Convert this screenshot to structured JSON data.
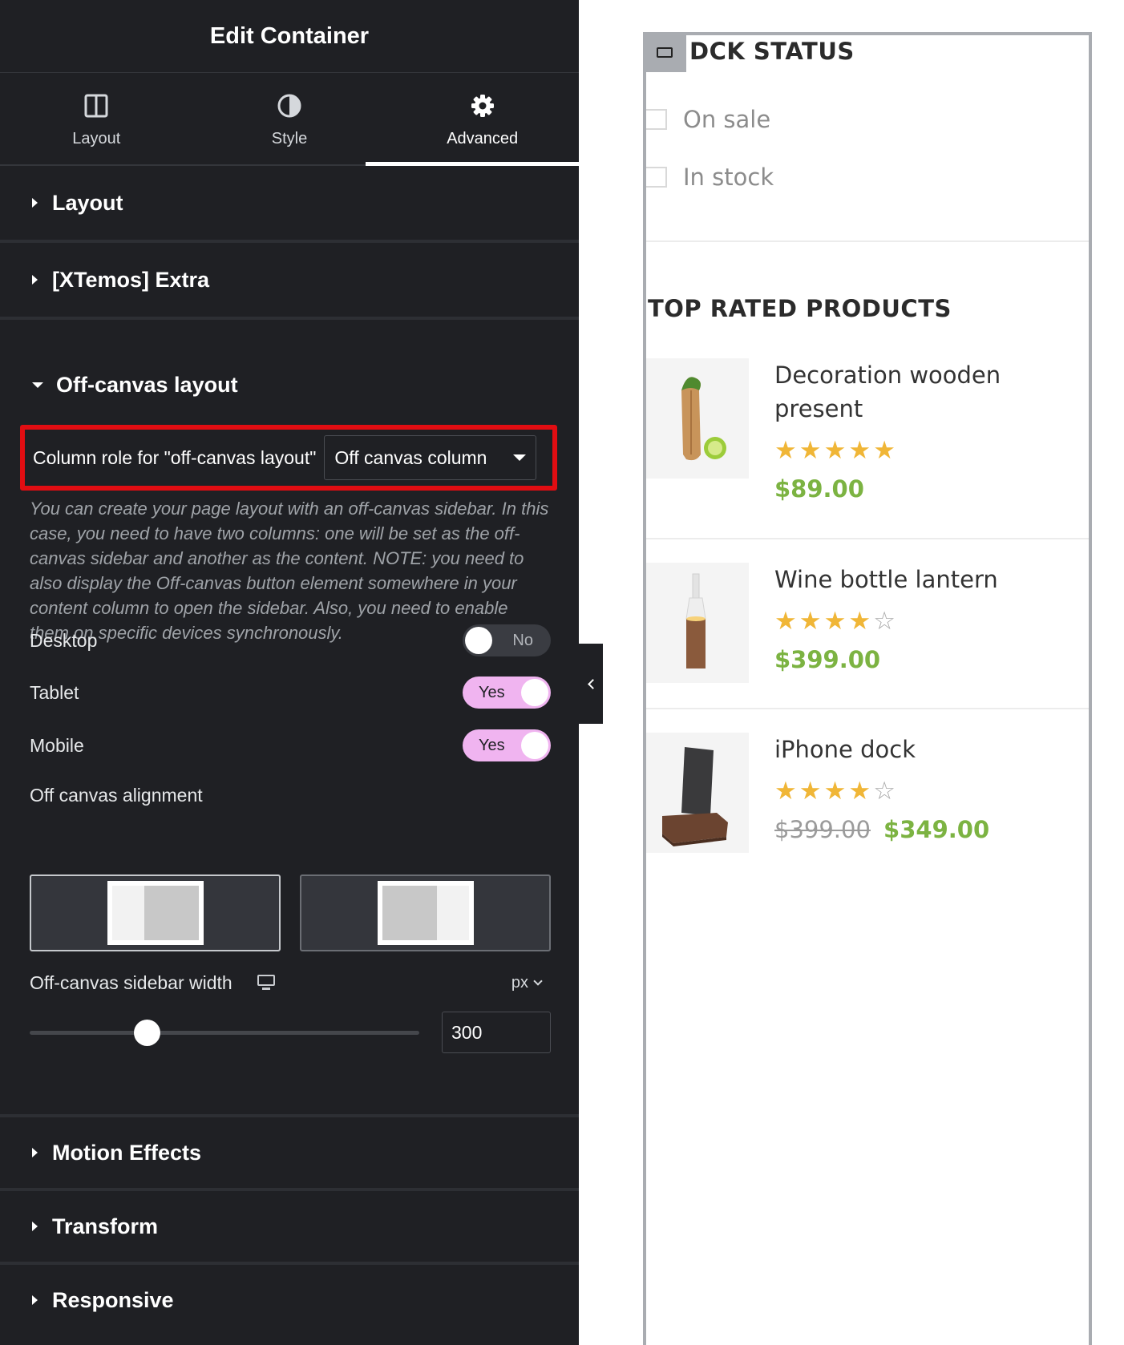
{
  "panel": {
    "title": "Edit Container",
    "tabs": [
      {
        "label": "Layout",
        "icon": "columns-icon",
        "active": false
      },
      {
        "label": "Style",
        "icon": "half-circle-icon",
        "active": false
      },
      {
        "label": "Advanced",
        "icon": "gear-icon",
        "active": true
      }
    ],
    "sections_top": [
      {
        "label": "Layout",
        "expanded": false
      },
      {
        "label": "[XTemos] Extra",
        "expanded": false
      }
    ],
    "offcanvas": {
      "title": "Off-canvas layout",
      "expanded": true,
      "column_role_label": "Column role for \"off-canvas layout\"",
      "column_role_value": "Off canvas column",
      "description": "You can create your page layout with an off-canvas sidebar. In this case, you need to have two columns: one will be set as the off-canvas sidebar and another as the content. NOTE: you need to also display the Off-canvas button element somewhere in your content column to open the sidebar. Also, you need to enable them on specific devices synchronously.",
      "devices": [
        {
          "label": "Desktop",
          "state": "No",
          "on": false
        },
        {
          "label": "Tablet",
          "state": "Yes",
          "on": true
        },
        {
          "label": "Mobile",
          "state": "Yes",
          "on": true
        }
      ],
      "alignment_label": "Off canvas alignment",
      "alignment_options": [
        "left",
        "right"
      ],
      "alignment_selected": "left",
      "sidebar_width_label": "Off-canvas sidebar width",
      "sidebar_width_unit": "px",
      "sidebar_width_value": "300",
      "sidebar_width_slider_fraction": 0.3
    },
    "sections_bottom": [
      {
        "label": "Motion Effects",
        "expanded": false
      },
      {
        "label": "Transform",
        "expanded": false
      },
      {
        "label": "Responsive",
        "expanded": false
      }
    ]
  },
  "preview": {
    "stock_status_title": "DCK STATUS",
    "stock_filters": [
      {
        "label": "On sale",
        "checked": false
      },
      {
        "label": "In stock",
        "checked": false
      }
    ],
    "top_rated_title": "TOP RATED PRODUCTS",
    "products": [
      {
        "name": "Decoration wooden present",
        "rating": 5,
        "old_price": "",
        "price": "$89.00"
      },
      {
        "name": "Wine bottle lantern",
        "rating": 4,
        "old_price": "",
        "price": "$399.00"
      },
      {
        "name": "iPhone dock",
        "rating": 4,
        "old_price": "$399.00",
        "price": "$349.00"
      }
    ]
  },
  "colors": {
    "panel_bg": "#1f2024",
    "highlight_border": "#e10d12",
    "toggle_on": "#f0b4f0",
    "star": "#f0b637",
    "price_green": "#7cb342"
  }
}
